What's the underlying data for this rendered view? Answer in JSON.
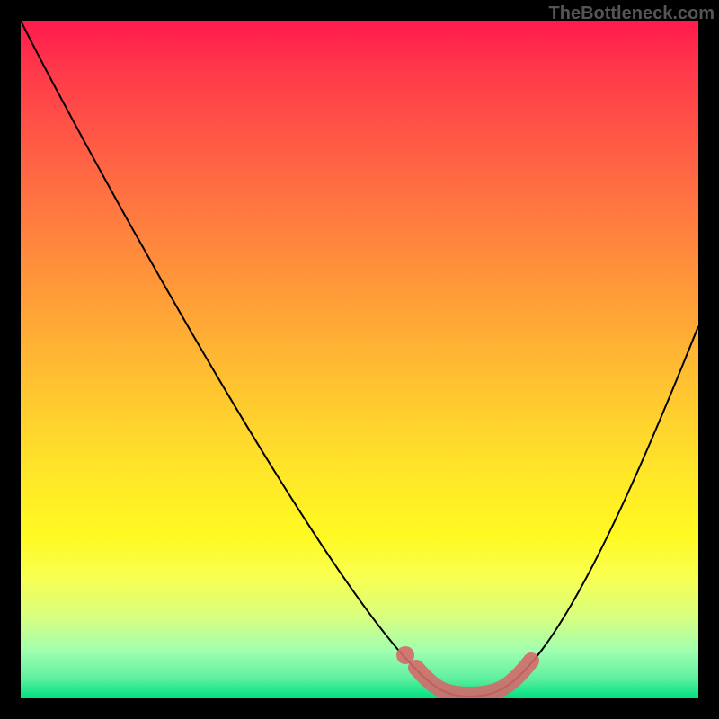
{
  "watermark": "TheBottleneck.com",
  "colors": {
    "background": "#000000",
    "gradient_top": "#ff1a4d",
    "gradient_bottom": "#00e080",
    "curve": "#000000",
    "marker": "#d46a6a"
  },
  "chart_data": {
    "type": "line",
    "title": "",
    "xlabel": "",
    "ylabel": "",
    "xlim": [
      0,
      100
    ],
    "ylim": [
      0,
      100
    ],
    "series": [
      {
        "name": "bottleneck-curve",
        "x": [
          0,
          5,
          10,
          15,
          20,
          25,
          30,
          35,
          40,
          45,
          50,
          55,
          60,
          62,
          64,
          66,
          68,
          70,
          72,
          74,
          76,
          80,
          85,
          90,
          95,
          100
        ],
        "values": [
          100,
          93,
          85,
          77,
          69,
          61,
          53,
          45,
          37,
          29,
          21,
          14,
          6,
          4,
          2,
          1,
          0,
          0,
          0,
          2,
          5,
          12,
          22,
          34,
          47,
          61
        ]
      }
    ],
    "highlight_region": {
      "x_start": 58,
      "x_end": 76,
      "description": "optimal-no-bottleneck-zone"
    }
  }
}
